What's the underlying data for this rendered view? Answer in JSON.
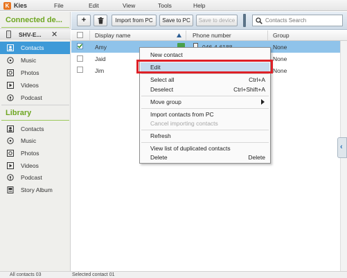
{
  "app": {
    "logo_letter": "K",
    "title": "Kies"
  },
  "menubar": {
    "items": [
      "File",
      "Edit",
      "View",
      "Tools",
      "Help"
    ]
  },
  "sidebar": {
    "connected_title": "Connected de...",
    "device_name": "SHV-E...",
    "device_close": "✕",
    "device_items": [
      {
        "label": "Contacts",
        "icon": "contacts-icon",
        "active": true
      },
      {
        "label": "Music",
        "icon": "music-icon"
      },
      {
        "label": "Photos",
        "icon": "photos-icon"
      },
      {
        "label": "Videos",
        "icon": "videos-icon"
      },
      {
        "label": "Podcast",
        "icon": "podcast-icon"
      }
    ],
    "library_title": "Library",
    "library_items": [
      {
        "label": "Contacts",
        "icon": "contacts-icon"
      },
      {
        "label": "Music",
        "icon": "music-icon"
      },
      {
        "label": "Photos",
        "icon": "photos-icon"
      },
      {
        "label": "Videos",
        "icon": "videos-icon"
      },
      {
        "label": "Podcast",
        "icon": "podcast-icon"
      },
      {
        "label": "Story Album",
        "icon": "story-album-icon"
      }
    ]
  },
  "toolbar": {
    "add_label": "+",
    "import_label": "Import from PC",
    "save_label": "Save to PC",
    "save_device_label": "Save to device",
    "search_placeholder": "Contacts Search"
  },
  "table": {
    "columns": [
      "Display name",
      "Phone number",
      "Group"
    ],
    "rows": [
      {
        "name": "Amy",
        "phone": "046-4-6188",
        "group": "None",
        "checked": true,
        "selected": true
      },
      {
        "name": "Jaid",
        "phone": "",
        "group": "None",
        "checked": false
      },
      {
        "name": "Jim",
        "phone": "",
        "group": "None",
        "checked": false
      }
    ]
  },
  "context_menu": {
    "new_contact": "New contact",
    "edit": "Edit",
    "select_all": "Select all",
    "select_all_shortcut": "Ctrl+A",
    "deselect": "Deselect",
    "deselect_shortcut": "Ctrl+Shift+A",
    "move_group": "Move group",
    "import_contacts": "Import contacts from PC",
    "cancel_importing": "Cancel importing contacts",
    "refresh": "Refresh",
    "view_duplicates": "View list of duplicated contacts",
    "delete": "Delete",
    "delete_shortcut": "Delete"
  },
  "statusbar": {
    "all_contacts": "All contacts 03",
    "selected_contact": "Selected contact 01"
  },
  "colors": {
    "accent_green": "#6ea621",
    "selection_blue": "#3e9ad8",
    "highlight_red": "#de2027"
  }
}
